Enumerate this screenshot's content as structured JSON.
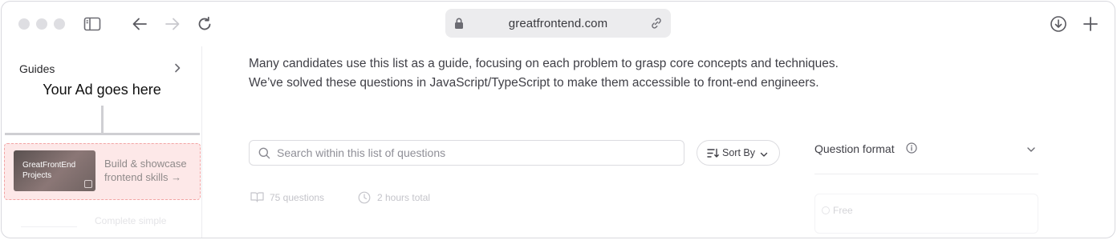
{
  "browser": {
    "url": "greatfrontend.com",
    "icons": [
      "traffic-light-dots",
      "sidebar-toggle-icon",
      "back-arrow-icon",
      "forward-arrow-icon",
      "reload-icon",
      "lock-icon",
      "link-icon",
      "download-icon",
      "plus-icon"
    ]
  },
  "sidebar": {
    "guides_label": "Guides",
    "ad_text": "Your Ad goes here",
    "promo": {
      "thumb_title": "GreatFrontEnd",
      "thumb_subtitle": "Projects",
      "copy": "Build & showcase frontend skills →",
      "background": "#fde8e8",
      "border": "#f3a4a4"
    },
    "faded_text": "Complete simple"
  },
  "main": {
    "intro": "Many candidates use this list as a guide, focusing on each problem to grasp core concepts and techniques. We’ve solved these questions in JavaScript/TypeScript to make them accessible to front-end engineers.",
    "search": {
      "placeholder": "Search within this list of questions",
      "value": ""
    },
    "sort_label": "Sort By",
    "stats": {
      "questions": "75 questions",
      "duration": "2 hours total"
    },
    "filters": {
      "question_format_label": "Question format",
      "first_option": "Free"
    }
  }
}
